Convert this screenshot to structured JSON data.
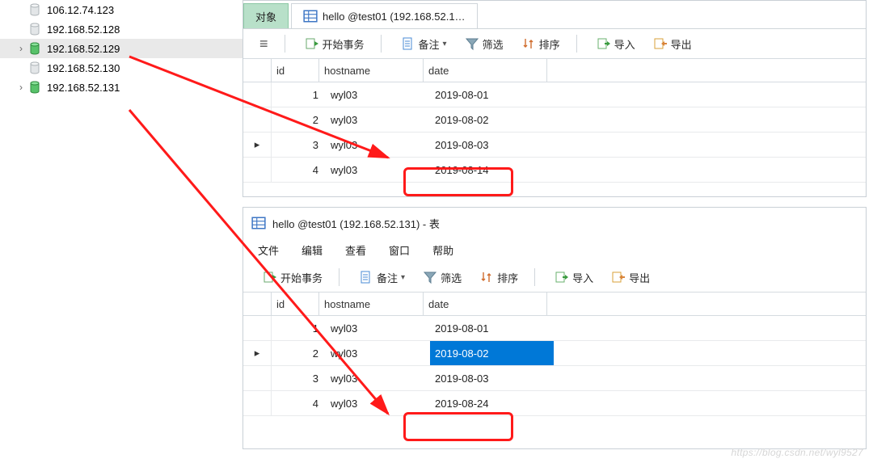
{
  "tree": {
    "items": [
      {
        "ip": "106.12.74.123",
        "selected": false,
        "expandable": false,
        "active": false
      },
      {
        "ip": "192.168.52.128",
        "selected": false,
        "expandable": false,
        "active": false
      },
      {
        "ip": "192.168.52.129",
        "selected": true,
        "expandable": true,
        "active": true
      },
      {
        "ip": "192.168.52.130",
        "selected": false,
        "expandable": false,
        "active": false
      },
      {
        "ip": "192.168.52.131",
        "selected": false,
        "expandable": true,
        "active": true
      }
    ]
  },
  "tabs": {
    "objects": "对象",
    "tableTab": "hello @test01 (192.168.52.1…"
  },
  "bottomTitle": "hello @test01 (192.168.52.131) - 表",
  "menus": {
    "file": "文件",
    "edit": "编辑",
    "view": "查看",
    "window": "窗口",
    "help": "帮助"
  },
  "toolbar": {
    "beginTx": "开始事务",
    "notes": "备注",
    "filter": "筛选",
    "sort": "排序",
    "import": "导入",
    "export": "导出"
  },
  "columns": {
    "id": "id",
    "hostname": "hostname",
    "date": "date"
  },
  "topRows": [
    {
      "id": "1",
      "hostname": "wyl03",
      "date": "2019-08-01",
      "cursor": false
    },
    {
      "id": "2",
      "hostname": "wyl03",
      "date": "2019-08-02",
      "cursor": false
    },
    {
      "id": "3",
      "hostname": "wyl03",
      "date": "2019-08-03",
      "cursor": true
    },
    {
      "id": "4",
      "hostname": "wyl03",
      "date": "2019-08-14",
      "cursor": false
    }
  ],
  "botRows": [
    {
      "id": "1",
      "hostname": "wyl03",
      "date": "2019-08-01",
      "cursor": false,
      "sel": false
    },
    {
      "id": "2",
      "hostname": "wyl03",
      "date": "2019-08-02",
      "cursor": true,
      "sel": true
    },
    {
      "id": "3",
      "hostname": "wyl03",
      "date": "2019-08-03",
      "cursor": false,
      "sel": false
    },
    {
      "id": "4",
      "hostname": "wyl03",
      "date": "2019-08-24",
      "cursor": false,
      "sel": false
    }
  ],
  "watermark": "https://blog.csdn.net/wyl9527"
}
